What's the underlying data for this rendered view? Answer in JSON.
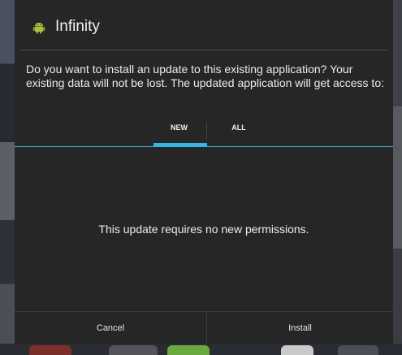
{
  "dialog": {
    "title": "Infinity",
    "app_icon": "android-robot-icon",
    "message": "Do you want to install an update to this existing application? Your existing data will not be lost. The updated application will get access to:",
    "tabs": [
      {
        "label": "NEW",
        "selected": true
      },
      {
        "label": "ALL",
        "selected": false
      }
    ],
    "permissions_text": "This update requires no new permissions.",
    "buttons": {
      "cancel_label": "Cancel",
      "install_label": "Install"
    }
  },
  "colors": {
    "accent": "#33b5e5",
    "dialog_background": "#262626",
    "icon_green": "#a4c639"
  }
}
